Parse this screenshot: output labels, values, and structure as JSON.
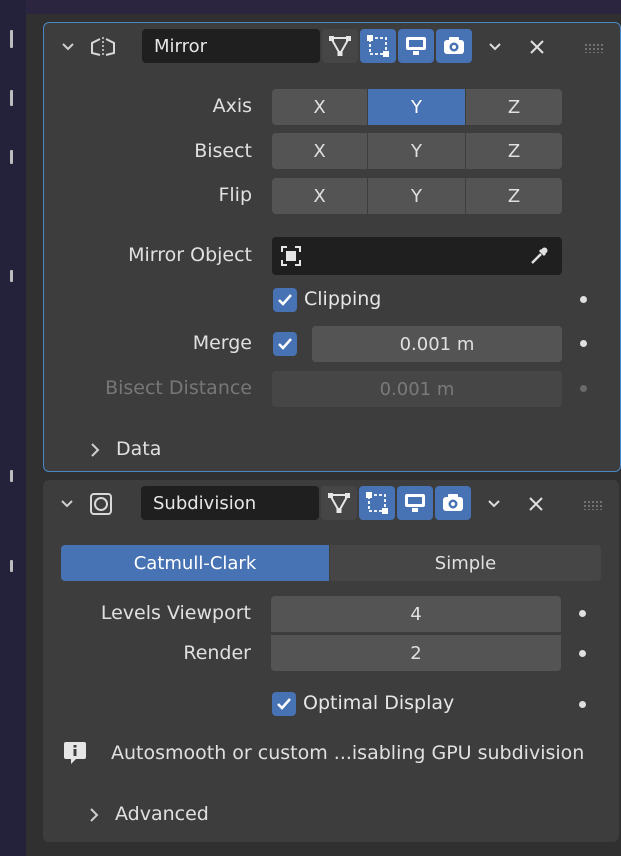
{
  "mirror": {
    "name": "Mirror",
    "axis_label": "Axis",
    "bisect_label": "Bisect",
    "flip_label": "Flip",
    "axis_options": [
      "X",
      "Y",
      "Z"
    ],
    "axis_selected": "Y",
    "mirror_object_label": "Mirror Object",
    "clipping_label": "Clipping",
    "clipping_checked": true,
    "merge_label": "Merge",
    "merge_checked": true,
    "merge_value": "0.001 m",
    "bisect_distance_label": "Bisect Distance",
    "bisect_distance_value": "0.001 m",
    "data_label": "Data"
  },
  "subdivision": {
    "name": "Subdivision",
    "mode_catmull": "Catmull-Clark",
    "mode_simple": "Simple",
    "mode_selected": "Catmull-Clark",
    "levels_viewport_label": "Levels Viewport",
    "levels_viewport_value": "4",
    "render_label": "Render",
    "render_value": "2",
    "optimal_display_label": "Optimal Display",
    "optimal_display_checked": true,
    "info_text": "Autosmooth or custom ...isabling GPU subdivision",
    "advanced_label": "Advanced"
  },
  "colors": {
    "accent": "#4772b3",
    "panel": "#3d3d3d",
    "field": "#545454",
    "active_outline": "#4a86c4"
  },
  "icons": [
    "chevron-down-icon",
    "mirror-modifier-icon",
    "subdivision-modifier-icon",
    "edit-mode-icon",
    "cage-icon",
    "viewport-display-icon",
    "render-camera-icon",
    "close-icon",
    "drag-grip-icon",
    "object-target-icon",
    "eyedropper-icon",
    "checkmark-icon",
    "info-icon",
    "chevron-right-icon"
  ]
}
